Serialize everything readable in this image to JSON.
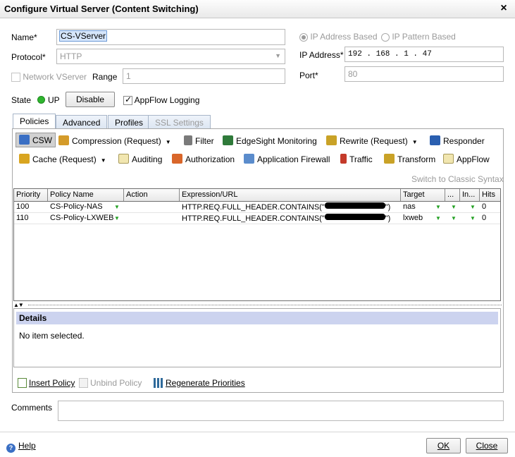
{
  "window": {
    "title": "Configure Virtual Server (Content Switching)",
    "close_glyph": "×"
  },
  "form": {
    "name_label": "Name*",
    "name_value": "CS-VServer",
    "protocol_label": "Protocol*",
    "protocol_value": "HTTP",
    "network_vserver_label": "Network VServer",
    "range_label": "Range",
    "range_value": "1",
    "ip_address_based_label": "IP Address Based",
    "ip_pattern_based_label": "IP Pattern Based",
    "ip_address_label": "IP Address*",
    "ip_address_value": "192 . 168 . 1 . 47",
    "port_label": "Port*",
    "port_value": "80",
    "state_label": "State",
    "state_value": "UP",
    "disable_button": "Disable",
    "appflow_logging_label": "AppFlow Logging"
  },
  "tabs": [
    "Policies",
    "Advanced",
    "Profiles",
    "SSL Settings"
  ],
  "toolbar": {
    "row1": [
      {
        "label": "CSW",
        "icon": "csw-icon",
        "color": "#3a6fc4"
      },
      {
        "label": "Compression (Request)",
        "icon": "compression-icon",
        "color": "#d49b2a",
        "dropdown": true
      },
      {
        "label": "Filter",
        "icon": "filter-icon",
        "color": "#7a7a7a"
      },
      {
        "label": "EdgeSight Monitoring",
        "icon": "monitoring-icon",
        "color": "#2f7a3a"
      },
      {
        "label": "Rewrite (Request)",
        "icon": "rewrite-icon",
        "color": "#c9a227",
        "dropdown": true
      },
      {
        "label": "Responder",
        "icon": "responder-icon",
        "color": "#2a5fb0"
      }
    ],
    "row2": [
      {
        "label": "Cache (Request)",
        "icon": "cache-icon",
        "color": "#d9a520",
        "dropdown": true
      },
      {
        "label": "Auditing",
        "icon": "auditing-icon",
        "color": "#f1e6b0"
      },
      {
        "label": "Authorization",
        "icon": "authorization-icon",
        "color": "#d9662a"
      },
      {
        "label": "Application Firewall",
        "icon": "firewall-icon",
        "color": "#5b8ccc"
      },
      {
        "label": "Traffic",
        "icon": "traffic-icon",
        "color": "#c43a2a"
      },
      {
        "label": "Transform",
        "icon": "transform-icon",
        "color": "#c9a227"
      },
      {
        "label": "AppFlow",
        "icon": "appflow-icon",
        "color": "#f1e6b0"
      }
    ]
  },
  "switch_classic_label": "Switch to Classic Syntax",
  "policy_table": {
    "headers": [
      "Priority",
      "Policy Name",
      "Action",
      "Expression/URL",
      "Target",
      "...",
      "In...",
      "Hits"
    ],
    "rows": [
      {
        "priority": "100",
        "policy_name": "CS-Policy-NAS",
        "action": "",
        "expression_prefix": "HTTP.REQ.FULL_HEADER.CONTAINS(\"",
        "expression_suffix": "\")",
        "target": "nas",
        "hits": "0"
      },
      {
        "priority": "110",
        "policy_name": "CS-Policy-LXWEB",
        "action": "",
        "expression_prefix": "HTTP.REQ.FULL_HEADER.CONTAINS(\"",
        "expression_suffix": "\")",
        "target": "lxweb",
        "hits": "0"
      }
    ]
  },
  "details": {
    "title": "Details",
    "text": "No item selected."
  },
  "bottom_links": {
    "insert_policy": "Insert Policy",
    "unbind_policy": "Unbind Policy",
    "regenerate_priorities": "Regenerate Priorities"
  },
  "comments_label": "Comments",
  "footer": {
    "help": "Help",
    "ok": "OK",
    "close": "Close"
  },
  "colors": {
    "state_up": "#2fb52f",
    "details_bg": "#ccd3ef",
    "indicator_green": "#22a022"
  }
}
